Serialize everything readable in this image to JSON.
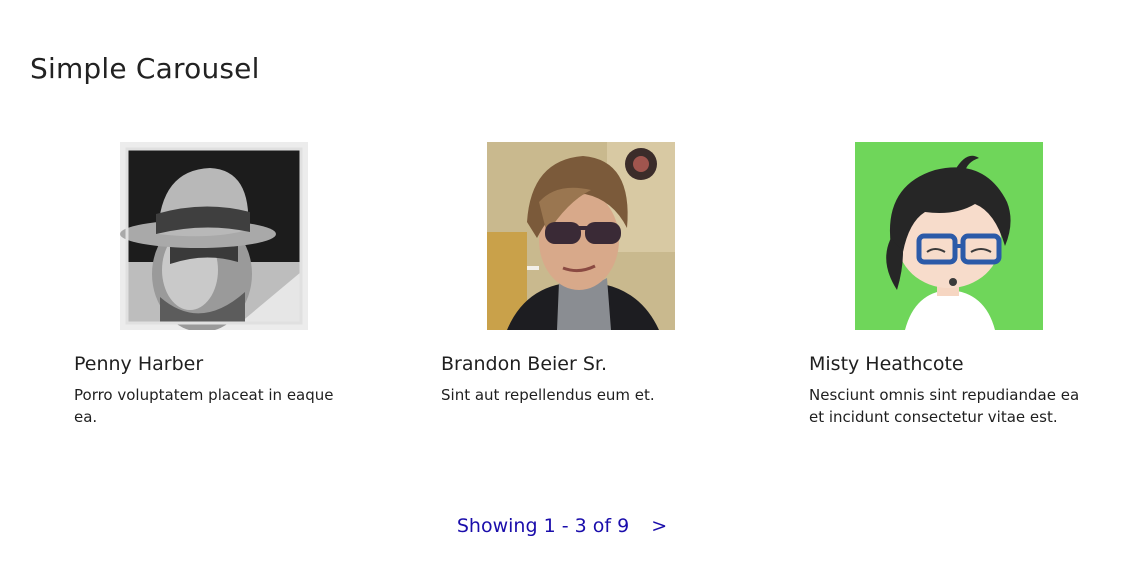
{
  "page": {
    "title": "Simple Carousel"
  },
  "carousel": {
    "cards": [
      {
        "name": "Penny Harber",
        "description": "Porro voluptatem placeat in eaque ea."
      },
      {
        "name": "Brandon Beier Sr.",
        "description": "Sint aut repellendus eum et."
      },
      {
        "name": "Misty Heathcote",
        "description": "Nesciunt omnis sint repudiandae ea et incidunt consectetur vitae est."
      }
    ]
  },
  "pager": {
    "status": "Showing 1 - 3 of 9",
    "next_label": ">",
    "link_color": "#1a0dab"
  }
}
